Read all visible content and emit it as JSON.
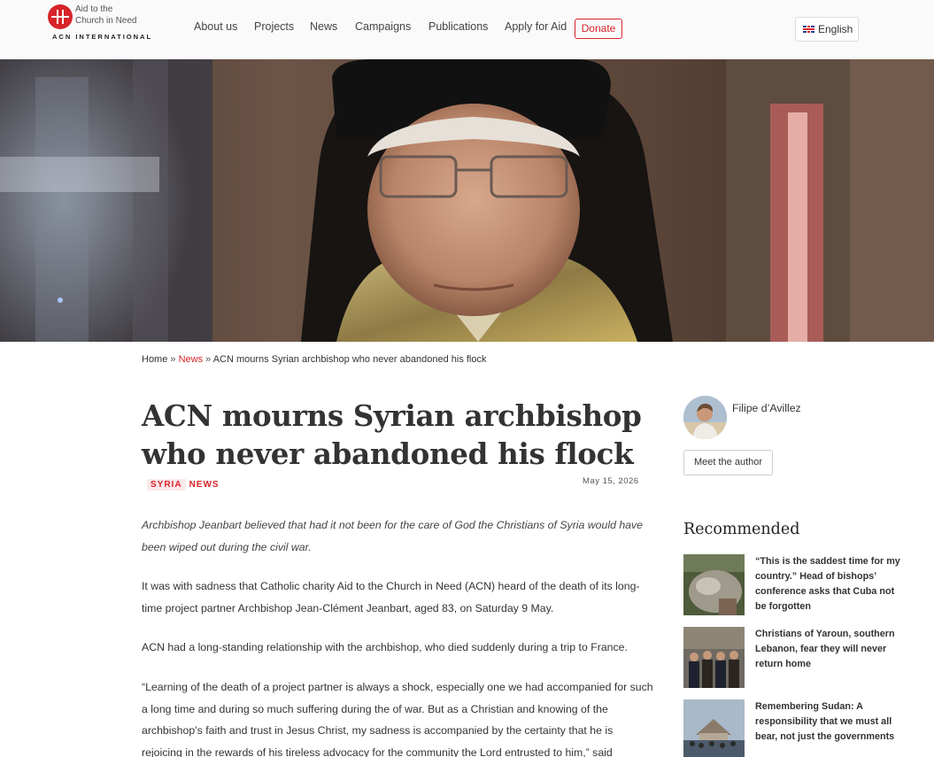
{
  "header": {
    "logo": {
      "line1": "Aid to the",
      "line2": "Church in Need",
      "sub": "ACN INTERNATIONAL"
    },
    "nav": [
      "About us",
      "Projects",
      "News",
      "Campaigns",
      "Publications",
      "Apply for Aid"
    ],
    "donate_label": "Donate",
    "language": {
      "label": "English",
      "flag_icon": "uk-flag-icon"
    }
  },
  "hero": {
    "icon": "hero-photo-archbishop"
  },
  "breadcrumb": {
    "home": "Home",
    "sep1": " » ",
    "news": "News",
    "sep2": " » ",
    "current": "ACN mourns Syrian archbishop who never abandoned his flock"
  },
  "article": {
    "title_line1": "ACN mourns Syrian archbishop",
    "title_line2": "who never abandoned his flock",
    "tags": [
      "SYRIA",
      "NEWS"
    ],
    "date": "May 15, 2026",
    "lead": "Archbishop Jeanbart believed that had it not been for the care of God the Christians of Syria would have been wiped out during the civil war.",
    "paragraphs": [
      "It was with sadness that Catholic charity Aid to the Church in Need (ACN) heard of the death of its long-time project partner Archbishop Jean-Clément Jeanbart, aged 83, on Saturday 9 May.",
      "ACN had a long-standing relationship with the archbishop, who died suddenly during a trip to France.",
      "“Learning of the death of a project partner is always a shock, especially one we had accompanied for such a long time and during so much suffering during the of war. But as a Christian and knowing of the archbishop’s faith and trust in Jesus Christ, my sadness is accompanied by the certainty that he is rejoicing in the rewards of his tireless advocacy for the community the Lord entrusted to him,” said"
    ]
  },
  "sidebar": {
    "author_name": "Filipe d’Avillez",
    "meet_label": "Meet the author",
    "recommended_heading": "Recommended",
    "recommended": [
      {
        "title": "“This is the saddest time for my country.” Head of bishops’ conference asks that Cuba not be forgotten"
      },
      {
        "title": "Christians of Yaroun, southern Lebanon, fear they will never return home"
      },
      {
        "title": "Remembering Sudan: A responsibility that we must all bear, not just the governments"
      }
    ]
  },
  "colors": {
    "accent": "#d8232a",
    "text": "#333333",
    "header_bg": "#fafafa"
  }
}
